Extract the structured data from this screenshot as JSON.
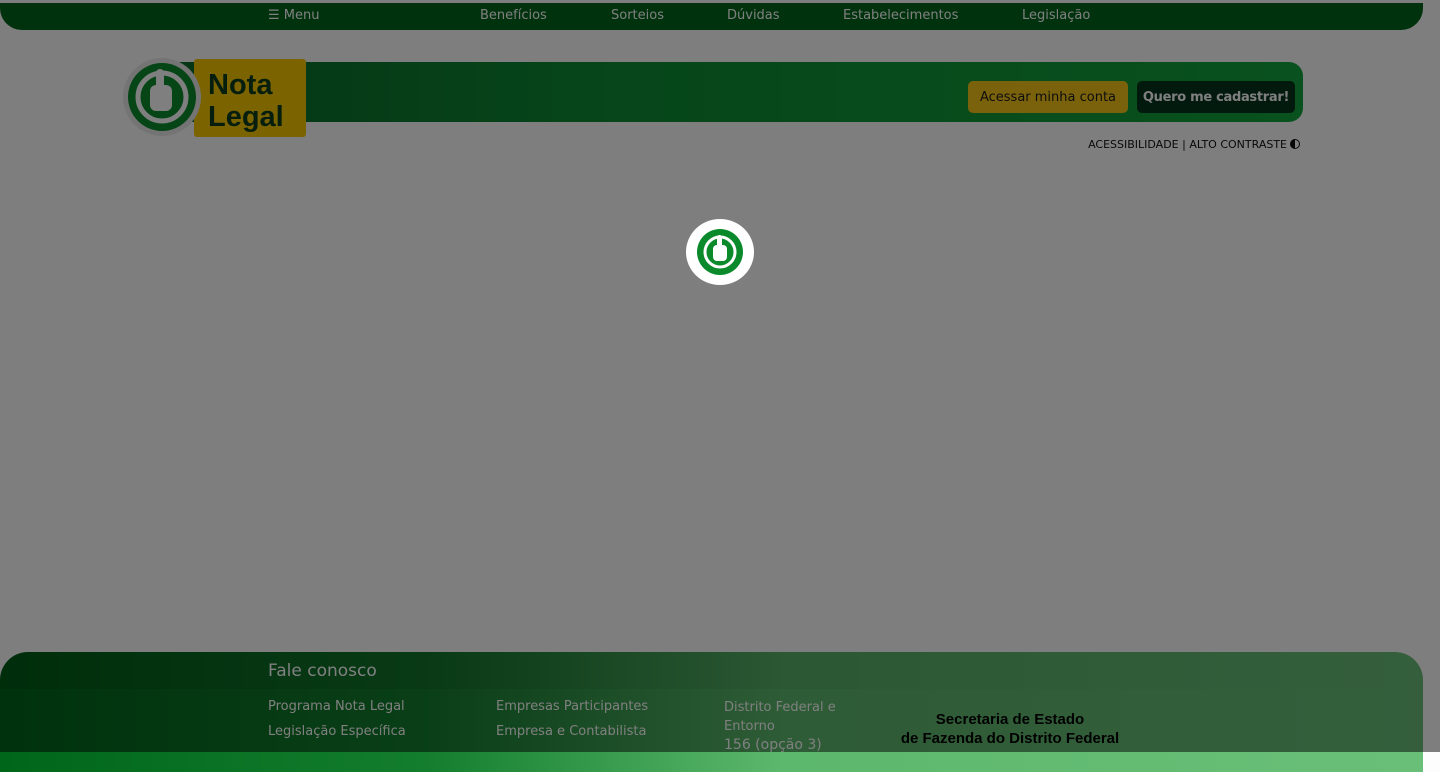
{
  "topnav": {
    "menu_label": "☰ Menu",
    "items": [
      "Benefícios",
      "Sorteios",
      "Dúvidas",
      "Estabelecimentos",
      "Legislação"
    ]
  },
  "header": {
    "logo_text_line1": "Nota",
    "logo_text_line2": "Legal",
    "account_button": "Acessar minha conta",
    "register_button": "Quero me cadastrar!",
    "accessibility": "ACESSIBILIDADE | ALTO CONTRASTE"
  },
  "footer": {
    "title": "Fale conosco",
    "col1": [
      "Programa Nota Legal",
      "Legislação Específica"
    ],
    "col2": [
      "Empresas Participantes",
      "Empresa e Contabilista"
    ],
    "contact_region": "Distrito Federal e Entorno",
    "contact_phone": "156 (opção 3)",
    "seal_line1": "Secretaria de Estado",
    "seal_line2": "de Fazenda do Distrito Federal"
  },
  "colors": {
    "brand_green": "#00661a",
    "accent_yellow": "#f5c518"
  },
  "icons": {
    "loader": "thumbs-up-icon",
    "contrast": "contrast-icon"
  }
}
